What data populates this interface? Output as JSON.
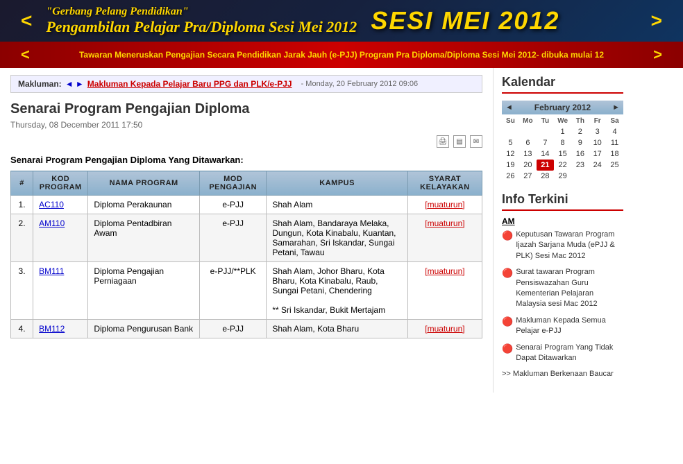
{
  "header": {
    "banner_title": "Pengambilan Pelajar Pra/Diploma Sesi Mei 2012",
    "banner_sesi": "SESI MEI 2012",
    "banner_sub": "Tawaran Meneruskan Pengajian Secara Pendidikan Jarak Jauh (e-PJJ) Program Pra Diploma/Diploma Sesi Mei 2012- dibuka mulai 12",
    "nav_prev": "<",
    "nav_next": ">"
  },
  "notice": {
    "label": "Makluman:",
    "icons": "◄ ►",
    "link": "Makluman Kepada Pelajar Baru PPG dan PLK/e-PJJ",
    "date": "- Monday, 20 February 2012 09:06"
  },
  "page": {
    "title": "Senarai Program Pengajian Diploma",
    "date": "Thursday, 08 December 2011 17:50"
  },
  "section_heading": "Senarai Program Pengajian Diploma Yang Ditawarkan:",
  "table": {
    "headers": [
      "#",
      "KOD PROGRAM",
      "NAMA PROGRAM",
      "MOD PENGAJIAN",
      "KAMPUS",
      "SYARAT KELAYAKAN"
    ],
    "rows": [
      {
        "num": "1.",
        "kod": "AC110",
        "nama": "Diploma Perakaunan",
        "mod": "e-PJJ",
        "kampus": "Shah Alam",
        "syarat": "[muaturun]"
      },
      {
        "num": "2.",
        "kod": "AM110",
        "nama": "Diploma Pentadbiran Awam",
        "mod": "e-PJJ",
        "kampus": "Shah Alam, Bandaraya Melaka, Dungun, Kota Kinabalu, Kuantan, Samarahan, Sri Iskandar, Sungai Petani, Tawau",
        "syarat": "[muaturun]"
      },
      {
        "num": "3.",
        "kod": "BM111",
        "nama": "Diploma Pengajian Perniagaan",
        "mod": "e-PJJ/**PLK",
        "kampus": "Shah Alam, Johor Bharu, Kota Bharu, Kota Kinabalu, Raub, Sungai Petani, Chendering\n** Sri Iskandar, Bukit Mertajam",
        "syarat": "[muaturun]"
      },
      {
        "num": "4.",
        "kod": "BM112",
        "nama": "Diploma Pengurusan Bank",
        "mod": "e-PJJ",
        "kampus": "Shah Alam, Kota Bharu",
        "syarat": "[muaturun]"
      }
    ]
  },
  "sidebar": {
    "calendar_title": "Kalendar",
    "calendar_month": "February 2012",
    "calendar_days_header": [
      "Su",
      "Mo",
      "Tu",
      "We",
      "Th",
      "Fr",
      "Sa"
    ],
    "calendar_weeks": [
      [
        "",
        "",
        "",
        "1",
        "2",
        "3",
        "4"
      ],
      [
        "5",
        "6",
        "7",
        "8",
        "9",
        "10",
        "11"
      ],
      [
        "12",
        "13",
        "14",
        "15",
        "16",
        "17",
        "18"
      ],
      [
        "19",
        "20",
        "21",
        "22",
        "23",
        "24",
        "25"
      ],
      [
        "26",
        "27",
        "28",
        "29",
        "",
        "",
        ""
      ]
    ],
    "today": "21",
    "info_title": "Info Terkini",
    "info_category": "AM",
    "info_items": [
      "Keputusan Tawaran Program Ijazah Sarjana Muda (ePJJ & PLK) Sesi Mac 2012",
      "Surat tawaran Program Pensiswazahan Guru Kementerian Pelajaran  Malaysia sesi Mac 2012",
      "Makluman Kepada Semua Pelajar e-PJJ",
      "Senarai Program Yang Tidak Dapat Ditawarkan"
    ],
    "info_arrow": ">> Makluman Berkenaan Baucar"
  },
  "icons": {
    "print": "🖨",
    "pdf": "📄",
    "email": "✉"
  }
}
